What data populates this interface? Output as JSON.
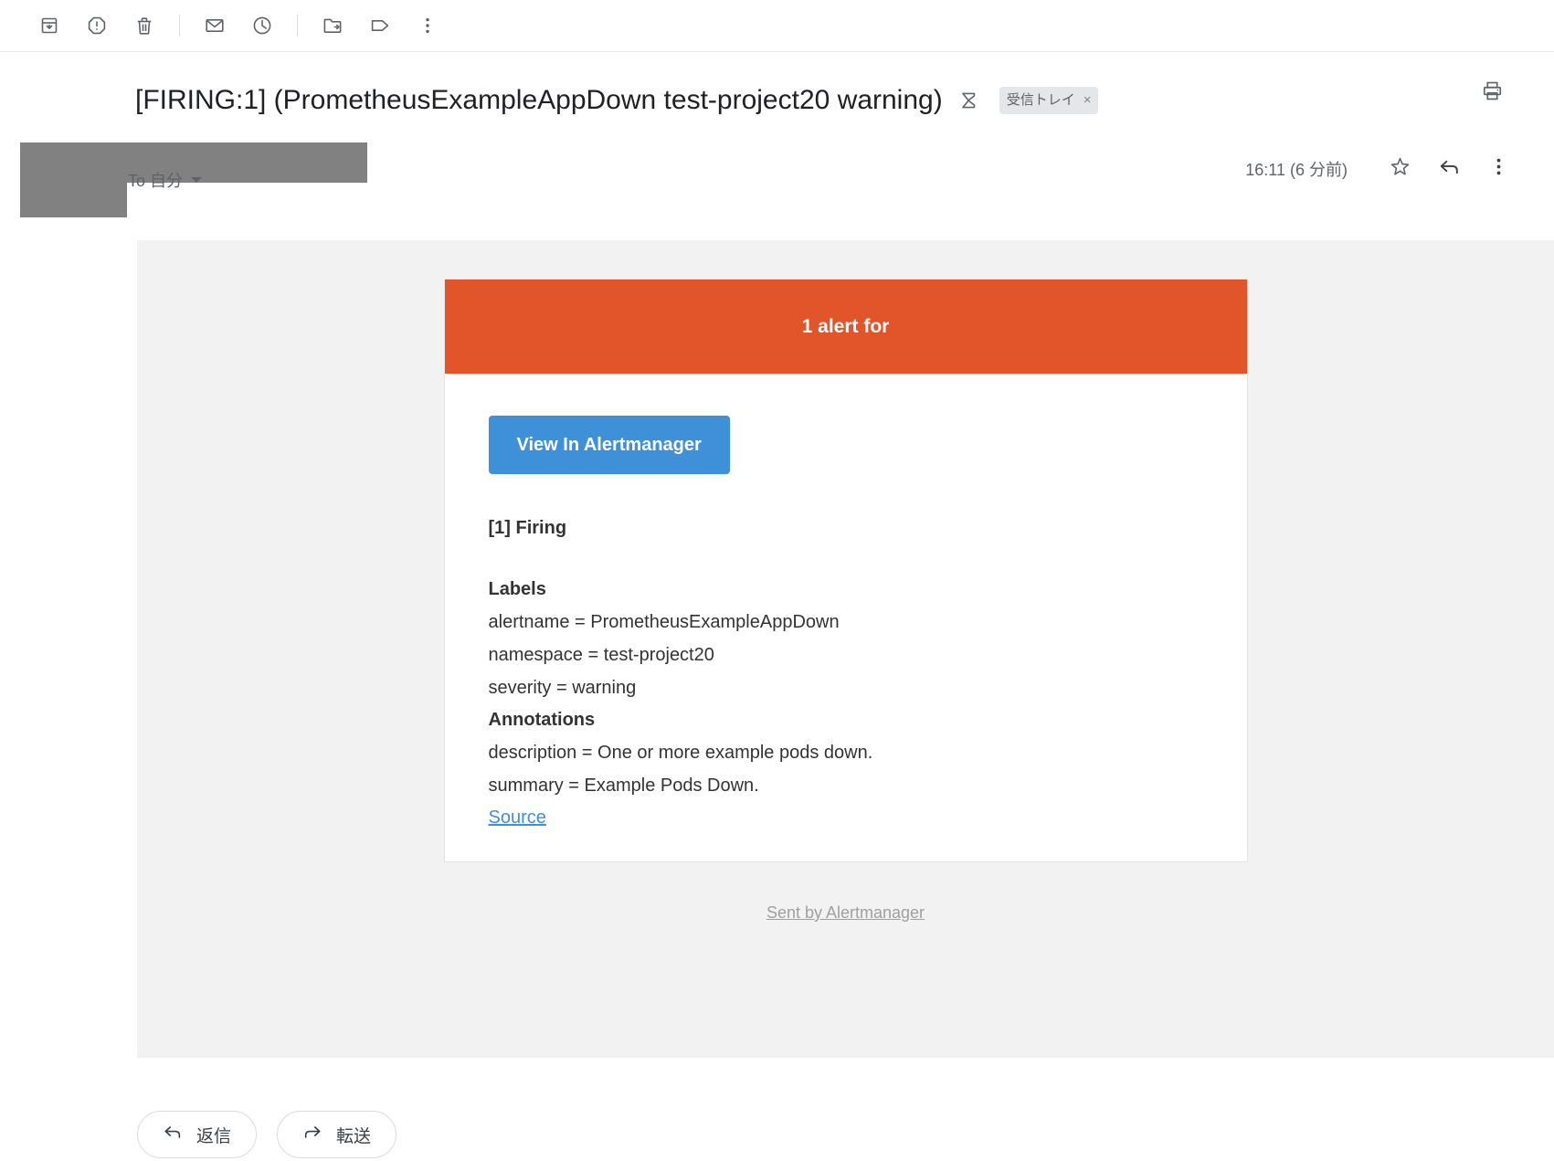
{
  "toolbar": {
    "buttons": [
      {
        "name": "archive-icon",
        "title": "アーカイブ"
      },
      {
        "name": "report-spam-icon",
        "title": "迷惑メールを報告"
      },
      {
        "name": "delete-icon",
        "title": "削除"
      },
      {
        "name": "mark-unread-icon",
        "title": "未読にする"
      },
      {
        "name": "snooze-icon",
        "title": "スヌーズ"
      },
      {
        "name": "move-to-icon",
        "title": "移動"
      },
      {
        "name": "labels-icon",
        "title": "ラベル"
      },
      {
        "name": "more-options-icon",
        "title": "その他"
      }
    ]
  },
  "subject": {
    "text": "[FIRING:1] (PrometheusExampleAppDown test-project20 warning)",
    "thread_icon": "sigma-thread-icon",
    "label_chip": "受信トレイ",
    "label_chip_close": "×",
    "print_icon": "print-icon"
  },
  "message_header": {
    "to_line": "To 自分",
    "date": "16:11 (6 分前)",
    "star_icon": "star-icon",
    "reply_icon": "reply-arrow-icon",
    "more_icon": "more-options-icon"
  },
  "email": {
    "banner": "1 alert for",
    "banner_color": "#e2552b",
    "button_label": "View In Alertmanager",
    "button_color": "#3e90d9",
    "firing_title": "[1] Firing",
    "labels_title": "Labels",
    "labels": [
      "alertname = PrometheusExampleAppDown",
      "namespace = test-project20",
      "severity = warning"
    ],
    "annotations_title": "Annotations",
    "annotations": [
      "description = One or more example pods down.",
      "summary = Example Pods Down."
    ],
    "source_link": "Source",
    "footer_link": "Sent by Alertmanager"
  },
  "footer": {
    "reply_label": "返信",
    "forward_label": "転送"
  }
}
